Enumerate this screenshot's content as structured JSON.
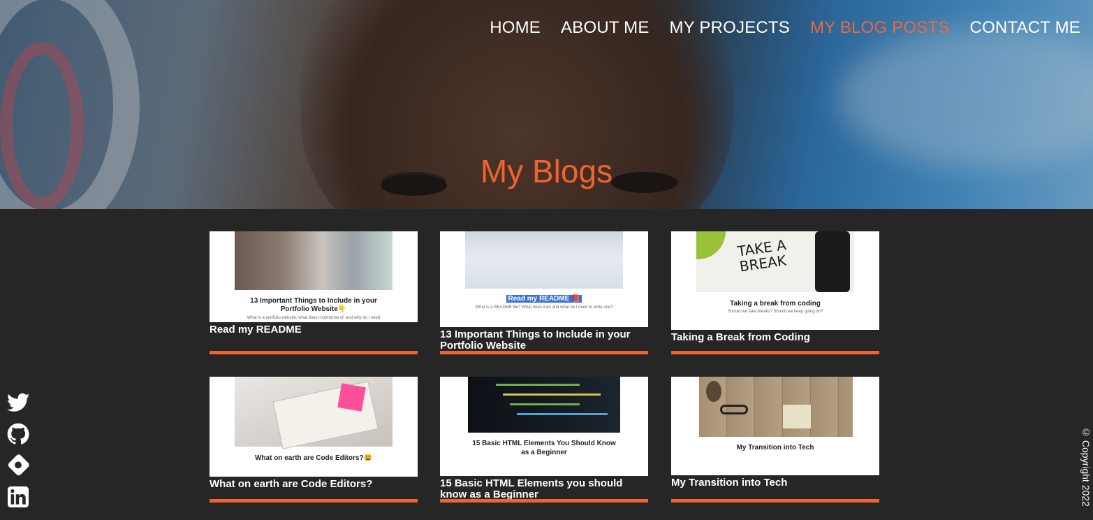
{
  "nav": {
    "items": [
      {
        "label": "HOME"
      },
      {
        "label": "ABOUT ME"
      },
      {
        "label": "MY PROJECTS"
      },
      {
        "label": "MY BLOG POSTS",
        "active": true
      },
      {
        "label": "CONTACT ME"
      }
    ]
  },
  "hero": {
    "title": "My Blogs"
  },
  "colors": {
    "accent": "#f0622e",
    "background": "#262626",
    "nav_active": "#f0683a"
  },
  "cards": [
    {
      "title": "Read my README",
      "thumb_title_line1": "13 Important Things to Include in your",
      "thumb_title_line2": "Portfolio Website👇",
      "thumb_sub": "What is a portfolio website, what does it comprise of, and why do I need"
    },
    {
      "title": "13 Important Things to Include in your Portfolio Website",
      "thumb_title_line1": "Read my README 📕",
      "thumb_sub": "What is a README file? What does it do and what do I need to write one?"
    },
    {
      "title": "Taking a Break from Coding",
      "thumb_title_line1": "Taking a break from coding",
      "thumb_sub": "Should we take breaks? Should we keep going on?",
      "photo_text": "TAKE A BREAK"
    },
    {
      "title": "What on earth are Code Editors?",
      "thumb_title_line1": "What on earth are Code Editors?😫"
    },
    {
      "title": "15 Basic HTML Elements you should know as a Beginner",
      "thumb_title_line1": "15 Basic HTML Elements You Should Know",
      "thumb_title_line2": "as a Beginner"
    },
    {
      "title": "My Transition into Tech",
      "thumb_title_line1": "My Transition into Tech"
    }
  ],
  "social": {
    "icons": [
      "twitter-icon",
      "github-icon",
      "hashnode-icon",
      "linkedin-icon"
    ]
  },
  "footer": {
    "copyright": "© Copyright 2022"
  }
}
